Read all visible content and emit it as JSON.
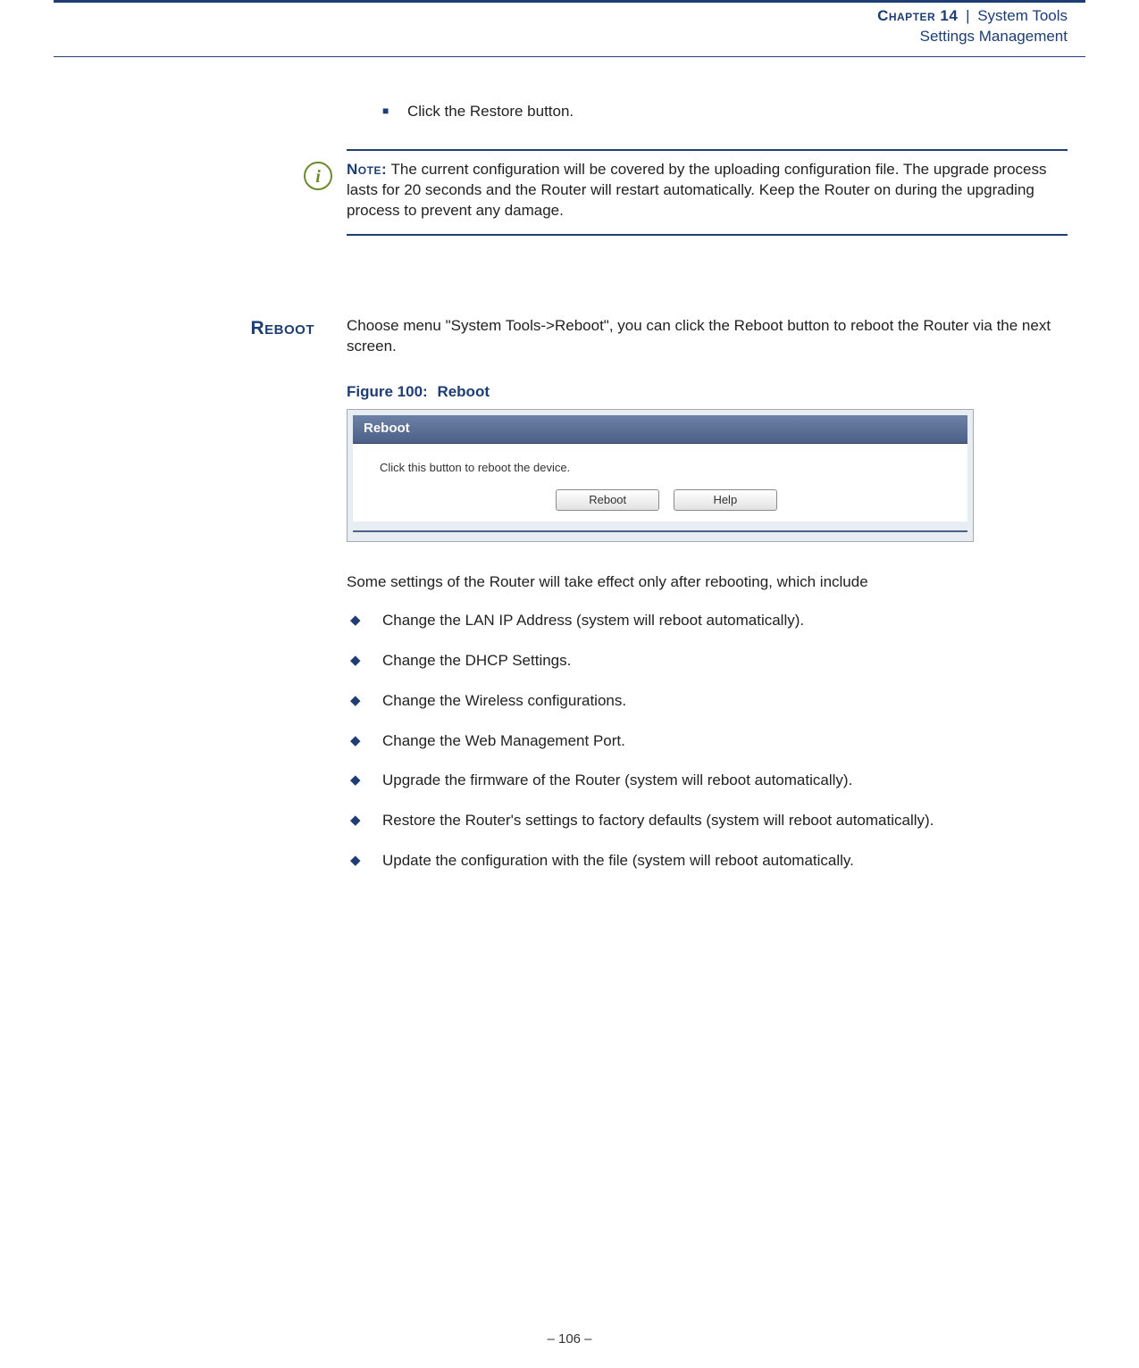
{
  "header": {
    "chapter": "Chapter 14",
    "separator": "|",
    "line1": "System Tools",
    "line2": "Settings Management"
  },
  "intro_bullet": "Click the Restore button.",
  "note": {
    "icon_char": "i",
    "label": "Note:",
    "text": "The current configuration will be covered by the uploading configuration file. The upgrade process lasts for 20 seconds and the Router will restart automatically. Keep the Router on during the upgrading process to prevent any damage."
  },
  "section": {
    "label": "Reboot",
    "intro": "Choose menu \"System Tools->Reboot\", you can click the Reboot button to reboot the Router via the next screen.",
    "figure": {
      "number": "Figure 100:",
      "title": "Reboot",
      "panel_title": "Reboot",
      "panel_desc": "Click this button to reboot the device.",
      "btn_reboot": "Reboot",
      "btn_help": "Help"
    },
    "after_figure": "Some settings of the Router will take effect only after rebooting, which include",
    "items": [
      "Change the LAN IP Address (system will reboot automatically).",
      "Change the DHCP Settings.",
      "Change the Wireless configurations.",
      "Change the Web Management Port.",
      "Upgrade the firmware of the Router (system will reboot automatically).",
      "Restore the Router's settings to factory defaults (system will reboot automatically).",
      "Update the configuration with the file (system will reboot automatically."
    ]
  },
  "footer": {
    "page": "–  106  –"
  }
}
